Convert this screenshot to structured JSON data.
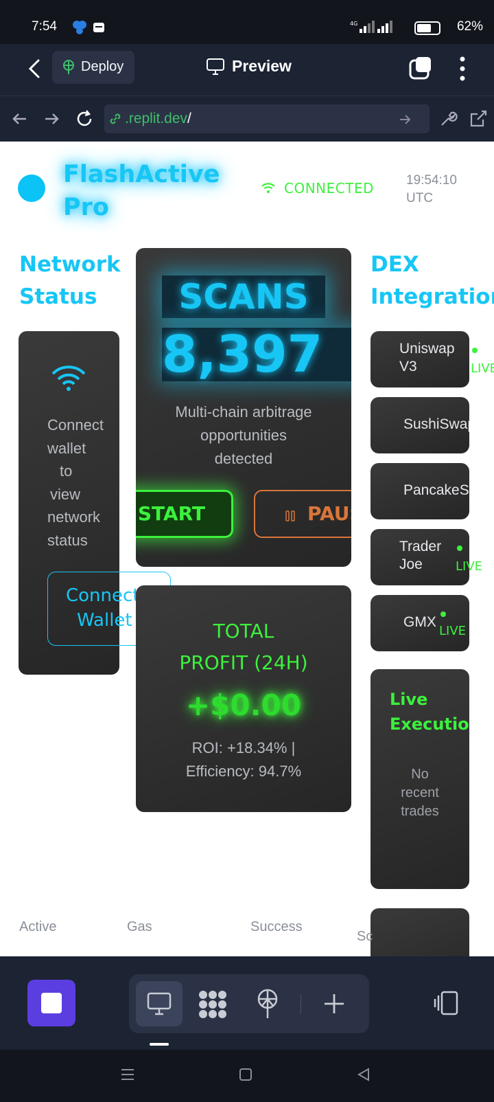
{
  "status_bar": {
    "time": "7:54",
    "network": "4G",
    "battery": "62%"
  },
  "header": {
    "deploy_label": "Deploy",
    "preview_label": "Preview"
  },
  "url_bar": {
    "url_domain": ".replit.dev",
    "url_path": "/"
  },
  "app": {
    "brand_line1": "FlashActive",
    "brand_line2": "Pro",
    "connection": "CONNECTED",
    "clock_time": "19:54:10",
    "clock_zone": "UTC",
    "network_status": {
      "title_line1": "Network",
      "title_line2": "Status",
      "message": [
        "Connect",
        "wallet",
        "to",
        "view",
        "network",
        "status"
      ],
      "connect_line1": "Connect",
      "connect_line2": "Wallet"
    },
    "scans": {
      "label": "SCANS",
      "count": "8,397",
      "desc_line1": "Multi-chain arbitrage",
      "desc_line2": "opportunities",
      "desc_line3": "detected",
      "start_label": "START",
      "pause_label": "PAUSE"
    },
    "profit": {
      "title_line1": "TOTAL",
      "title_line2": "PROFIT (24H)",
      "amount": "+$0.00",
      "roi_line": "ROI: +18.34% |",
      "efficiency_line": "Efficiency: 94.7%"
    },
    "dex": {
      "title_line1": "DEX",
      "title_line2": "Integration",
      "items": [
        {
          "name_line1": "Uniswap",
          "name_line2": "V3",
          "badge": "LIVE"
        },
        {
          "name_line1": "SushiSwap",
          "name_line2": "",
          "badge": ""
        },
        {
          "name_line1": "PancakeSwap",
          "name_line2": "",
          "badge": ""
        },
        {
          "name_line1": "Trader",
          "name_line2": "Joe",
          "badge": "LIVE"
        },
        {
          "name_line1": "GMX",
          "name_line2": "",
          "badge": "LIVE"
        }
      ]
    },
    "live_execution": {
      "title_line1": "Live",
      "title_line2": "Execution",
      "empty_line1": "No",
      "empty_line2": "recent",
      "empty_line3": "trades"
    },
    "stats_labels": [
      "Active",
      "Gas",
      "Success",
      "Sc"
    ]
  },
  "colors": {
    "neon_blue": "#17c6f5",
    "neon_green": "#3cf13c",
    "pause_orange": "#d9763a",
    "card_bg": "#303030"
  }
}
